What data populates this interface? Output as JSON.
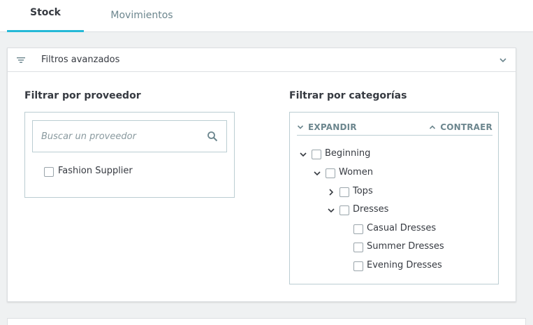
{
  "tabs": [
    {
      "label": "Stock",
      "active": true
    },
    {
      "label": "Movimientos",
      "active": false
    }
  ],
  "filters_card": {
    "title": "Filtros avanzados",
    "icons": {
      "filter": "filter-list-icon",
      "toggle": "chevron-down-icon"
    }
  },
  "supplier_filter": {
    "title": "Filtrar por proveedor",
    "search_placeholder": "Buscar un proveedor",
    "search_value": "",
    "suppliers": [
      {
        "label": "Fashion Supplier",
        "checked": false
      }
    ]
  },
  "category_filter": {
    "title": "Filtrar por categorías",
    "expand_label": "EXPANDIR",
    "collapse_label": "CONTRAER",
    "tree": [
      {
        "label": "Beginning",
        "toggle": "expanded",
        "checked": false
      },
      {
        "label": "Women",
        "toggle": "expanded",
        "checked": false
      },
      {
        "label": "Tops",
        "toggle": "collapsed",
        "checked": false
      },
      {
        "label": "Dresses",
        "toggle": "expanded",
        "checked": false
      },
      {
        "label": "Casual Dresses",
        "toggle": "none",
        "checked": false
      },
      {
        "label": "Summer Dresses",
        "toggle": "none",
        "checked": false
      },
      {
        "label": "Evening Dresses",
        "toggle": "none",
        "checked": false
      }
    ]
  },
  "colors": {
    "accent": "#25b9d7",
    "border": "#bbcdd2",
    "muted": "#6c868e",
    "text": "#363a41",
    "background": "#eff1f2"
  }
}
